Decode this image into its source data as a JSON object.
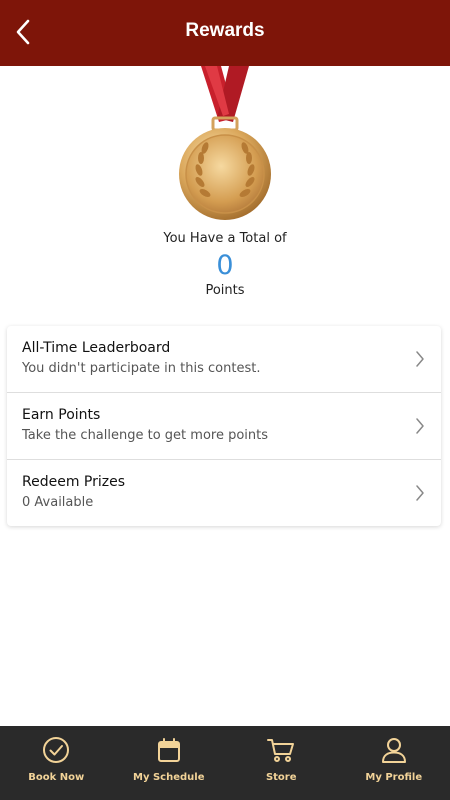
{
  "header": {
    "title": "Rewards"
  },
  "summary": {
    "total_label": "You Have a Total of",
    "points_value": "0",
    "points_label": "Points"
  },
  "menu": [
    {
      "title": "All-Time Leaderboard",
      "subtitle": "You didn't participate in this contest."
    },
    {
      "title": "Earn Points",
      "subtitle": "Take the challenge to get more points"
    },
    {
      "title": "Redeem Prizes",
      "subtitle": "0 Available"
    }
  ],
  "tabs": [
    {
      "label": "Book Now",
      "icon": "check-circle-icon"
    },
    {
      "label": "My Schedule",
      "icon": "calendar-icon"
    },
    {
      "label": "Store",
      "icon": "cart-icon"
    },
    {
      "label": "My Profile",
      "icon": "person-icon"
    }
  ],
  "colors": {
    "header_bg": "#7e1509",
    "points_value": "#3a8fd8",
    "tabbar_bg": "#2a2a2a",
    "tab_accent": "#f2d398"
  }
}
